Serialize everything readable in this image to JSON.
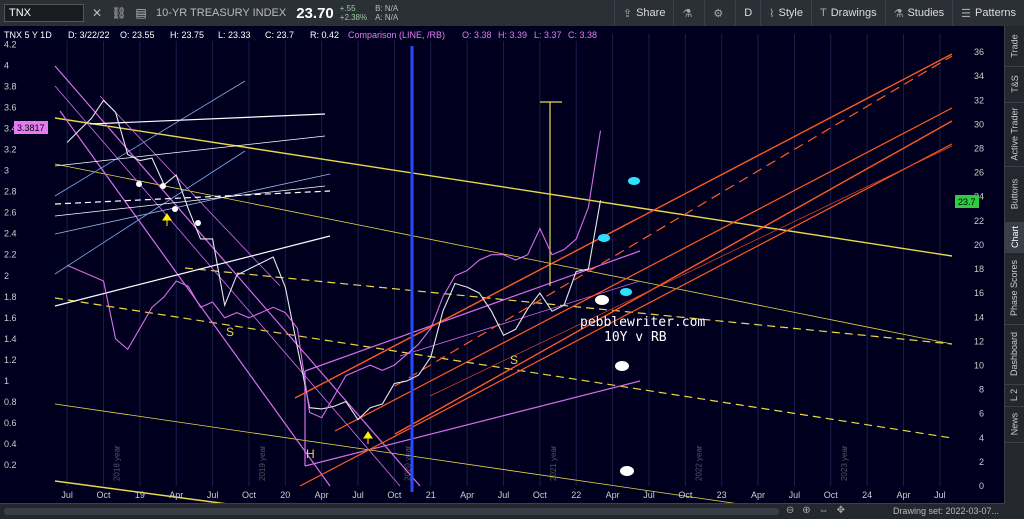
{
  "toolbar": {
    "symbol": "TNX",
    "title": "10-YR TREASURY INDEX",
    "price": "23.70",
    "change": "+.55",
    "change_pct": "+2.38%",
    "bid": "B: N/A",
    "ask": "A: N/A",
    "share": "Share",
    "timeframe": "D",
    "style": "Style",
    "drawings": "Drawings",
    "studies": "Studies",
    "patterns": "Patterns"
  },
  "header": {
    "symbol_info": "TNX 5 Y 1D",
    "date": "D: 3/22/22",
    "open": "O: 23.55",
    "high": "H: 23.75",
    "low": "L: 23.33",
    "close": "C: 23.7",
    "range": "R: 0.42",
    "comparison": "Comparison (LINE, /RB)",
    "comp_open": "O: 3.38",
    "comp_high": "H: 3.39",
    "comp_low": "L: 3.37",
    "comp_close": "C: 3.38"
  },
  "right_tabs": [
    "Trade",
    "T&S",
    "Active Trader",
    "Buttons",
    "Chart",
    "Phase Scores",
    "Dashboard",
    "L 2",
    "News"
  ],
  "status": {
    "drawing_set": "Drawing set: 2022-03-07..."
  },
  "chart_data": {
    "type": "line",
    "left_axis": {
      "ticks": [
        0.2,
        0.4,
        0.6,
        0.8,
        1,
        1.2,
        1.4,
        1.6,
        1.8,
        2,
        2.2,
        2.4,
        2.6,
        2.8,
        3,
        3.2,
        3.4,
        3.6,
        3.8,
        4,
        4.2
      ],
      "range": [
        0,
        4.3
      ]
    },
    "right_axis": {
      "ticks": [
        0,
        2,
        4,
        6,
        8,
        10,
        12,
        14,
        16,
        18,
        20,
        22,
        24,
        26,
        28,
        30,
        32,
        34,
        36
      ],
      "range": [
        0,
        37.5
      ]
    },
    "x_ticks": [
      "Jul",
      "Oct",
      "19",
      "Apr",
      "Jul",
      "Oct",
      "20",
      "Apr",
      "Jul",
      "Oct",
      "21",
      "Apr",
      "Jul",
      "Oct",
      "22",
      "Apr",
      "Jul",
      "Oct",
      "23",
      "Apr",
      "Jul",
      "Oct",
      "24",
      "Apr",
      "Jul"
    ],
    "year_labels": [
      "2018 year",
      "2019 year",
      "2020 year",
      "2021 year",
      "2022 year",
      "2023 year"
    ],
    "last_price_left": "3.3817",
    "last_price_right": "23.7",
    "annotations": {
      "site": "pebblewriter.com",
      "subtitle": "10Y v RB",
      "labels": [
        "S",
        "H",
        "S"
      ]
    },
    "series": [
      {
        "name": "TNX",
        "color": "#e8e8e8",
        "x": [
          "2018-07",
          "2018-08",
          "2018-09",
          "2018-10",
          "2018-11",
          "2018-12",
          "2019-01",
          "2019-02",
          "2019-03",
          "2019-04",
          "2019-05",
          "2019-06",
          "2019-07",
          "2019-08",
          "2019-09",
          "2019-10",
          "2019-11",
          "2019-12",
          "2020-01",
          "2020-02",
          "2020-03",
          "2020-04",
          "2020-05",
          "2020-06",
          "2020-07",
          "2020-08",
          "2020-09",
          "2020-10",
          "2020-11",
          "2020-12",
          "2021-01",
          "2021-02",
          "2021-03",
          "2021-04",
          "2021-05",
          "2021-06",
          "2021-07",
          "2021-08",
          "2021-09",
          "2021-10",
          "2021-11",
          "2021-12",
          "2022-01",
          "2022-02",
          "2022-03"
        ],
        "values": [
          28.5,
          29.5,
          30.5,
          32.0,
          31.0,
          27.5,
          27.0,
          27.2,
          25.0,
          25.8,
          23.0,
          20.5,
          20.5,
          15.0,
          17.5,
          18.0,
          18.5,
          19.0,
          16.5,
          11.5,
          6.5,
          6.4,
          6.6,
          7.0,
          5.5,
          6.5,
          6.8,
          8.5,
          8.7,
          9.2,
          10.7,
          14.5,
          16.8,
          16.5,
          16.0,
          14.5,
          12.5,
          13.0,
          14.7,
          16.0,
          14.5,
          15.0,
          17.8,
          18.0,
          23.7
        ]
      },
      {
        "name": "/RB",
        "color": "#d76ee8",
        "x": [
          "2018-07",
          "2018-08",
          "2018-09",
          "2018-10",
          "2018-11",
          "2018-12",
          "2019-01",
          "2019-02",
          "2019-03",
          "2019-04",
          "2019-05",
          "2019-06",
          "2019-07",
          "2019-08",
          "2019-09",
          "2019-10",
          "2019-11",
          "2019-12",
          "2020-01",
          "2020-02",
          "2020-03",
          "2020-04",
          "2020-05",
          "2020-06",
          "2020-07",
          "2020-08",
          "2020-09",
          "2020-10",
          "2020-11",
          "2020-12",
          "2021-01",
          "2021-02",
          "2021-03",
          "2021-04",
          "2021-05",
          "2021-06",
          "2021-07",
          "2021-08",
          "2021-09",
          "2021-10",
          "2021-11",
          "2021-12",
          "2022-01",
          "2022-02",
          "2022-03"
        ],
        "values": [
          2.1,
          2.05,
          2.0,
          1.95,
          1.4,
          1.3,
          1.5,
          1.7,
          1.8,
          1.95,
          1.9,
          1.7,
          1.75,
          1.6,
          1.65,
          1.6,
          1.65,
          1.7,
          1.65,
          1.5,
          0.7,
          0.65,
          0.85,
          1.05,
          1.1,
          1.15,
          1.1,
          1.15,
          1.25,
          1.35,
          1.5,
          1.8,
          2.0,
          2.05,
          2.15,
          2.2,
          2.2,
          2.15,
          2.2,
          2.45,
          2.2,
          2.25,
          2.35,
          2.65,
          3.38
        ]
      }
    ]
  }
}
